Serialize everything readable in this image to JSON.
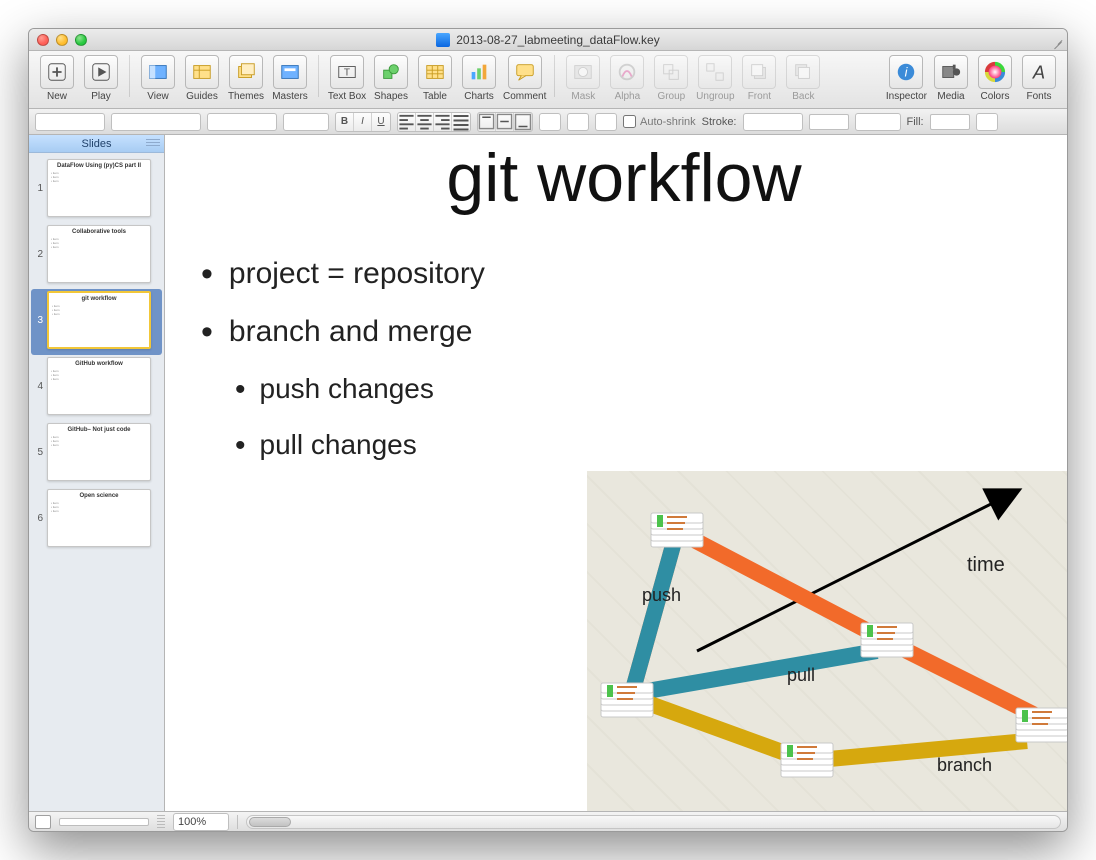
{
  "window": {
    "title": "2013-08-27_labmeeting_dataFlow.key"
  },
  "toolbar": {
    "items": [
      {
        "id": "new",
        "label": "New",
        "interactable": true,
        "icon": "plus"
      },
      {
        "id": "play",
        "label": "Play",
        "interactable": true,
        "icon": "play"
      },
      {
        "id": "view",
        "label": "View",
        "interactable": true,
        "icon": "view"
      },
      {
        "id": "guides",
        "label": "Guides",
        "interactable": true,
        "icon": "guides"
      },
      {
        "id": "themes",
        "label": "Themes",
        "interactable": true,
        "icon": "themes"
      },
      {
        "id": "masters",
        "label": "Masters",
        "interactable": true,
        "icon": "masters"
      },
      {
        "id": "textbox",
        "label": "Text Box",
        "interactable": true,
        "icon": "textbox"
      },
      {
        "id": "shapes",
        "label": "Shapes",
        "interactable": true,
        "icon": "shapes"
      },
      {
        "id": "table",
        "label": "Table",
        "interactable": true,
        "icon": "table"
      },
      {
        "id": "charts",
        "label": "Charts",
        "interactable": true,
        "icon": "charts"
      },
      {
        "id": "comment",
        "label": "Comment",
        "interactable": true,
        "icon": "comment"
      },
      {
        "id": "mask",
        "label": "Mask",
        "interactable": false,
        "icon": "mask"
      },
      {
        "id": "alpha",
        "label": "Alpha",
        "interactable": false,
        "icon": "alpha"
      },
      {
        "id": "group",
        "label": "Group",
        "interactable": false,
        "icon": "group"
      },
      {
        "id": "ungroup",
        "label": "Ungroup",
        "interactable": false,
        "icon": "ungroup"
      },
      {
        "id": "front",
        "label": "Front",
        "interactable": false,
        "icon": "front"
      },
      {
        "id": "back",
        "label": "Back",
        "interactable": false,
        "icon": "back"
      },
      {
        "id": "inspector",
        "label": "Inspector",
        "interactable": true,
        "icon": "inspector"
      },
      {
        "id": "media",
        "label": "Media",
        "interactable": true,
        "icon": "media"
      },
      {
        "id": "colors",
        "label": "Colors",
        "interactable": true,
        "icon": "colors"
      },
      {
        "id": "fonts",
        "label": "Fonts",
        "interactable": true,
        "icon": "fonts"
      }
    ]
  },
  "formatbar": {
    "autoshrink_label": "Auto-shrink",
    "stroke_label": "Stroke:",
    "fill_label": "Fill:"
  },
  "sidebar": {
    "header": "Slides",
    "slides": [
      {
        "n": "1",
        "title": "DataFlow Using (py)CS part II"
      },
      {
        "n": "2",
        "title": "Collaborative tools"
      },
      {
        "n": "3",
        "title": "git workflow"
      },
      {
        "n": "4",
        "title": "GitHub workflow"
      },
      {
        "n": "5",
        "title": "GitHub– Not just code"
      },
      {
        "n": "6",
        "title": "Open science"
      }
    ],
    "selected_index": 2
  },
  "slide": {
    "title": "git workflow",
    "bullets": [
      {
        "text": "project = repository"
      },
      {
        "text": "branch and merge",
        "children": [
          {
            "text": "push changes"
          },
          {
            "text": "pull changes"
          }
        ]
      }
    ],
    "diagram_labels": {
      "push": "push",
      "pull": "pull",
      "branch": "branch",
      "time": "time"
    }
  },
  "statusbar": {
    "zoom": "100%"
  }
}
